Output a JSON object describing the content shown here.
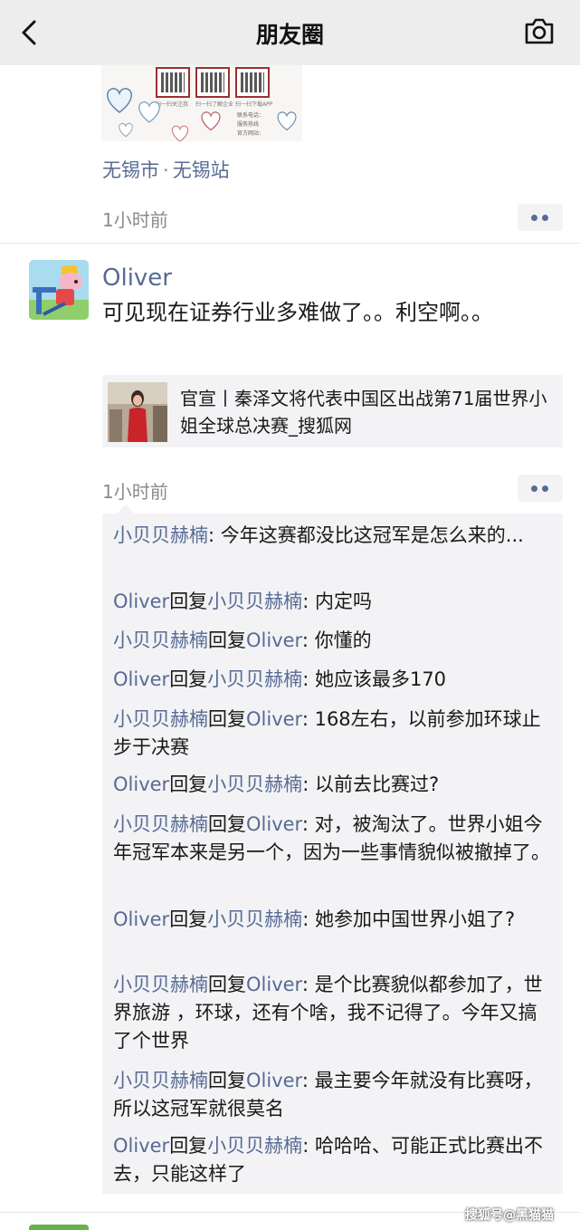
{
  "header": {
    "title": "朋友圈",
    "back_icon": "chevron-left-icon",
    "camera_icon": "camera-icon"
  },
  "prev_post": {
    "image": {
      "qr_captions": [
        "扫一扫关注我",
        "扫一扫了解企业",
        "扫一扫下载APP"
      ],
      "text_lines": [
        "联系电话：",
        "服务热线",
        "官方网站："
      ]
    },
    "location": {
      "city": "无锡市",
      "separator": "·",
      "place": "无锡站"
    },
    "time": "1小时前"
  },
  "post": {
    "nickname": "Oliver",
    "text": "可见现在证券行业多难做了。。利空啊。。",
    "link": {
      "title": "官宣丨秦泽文将代表中国区出战第71届世界小姐全球总决赛_搜狐网"
    },
    "time": "1小时前",
    "comments": [
      {
        "from": "小贝贝赫楠",
        "reply_word": "",
        "to": "",
        "sep": ": ",
        "text": "今年这赛都没比这冠军是怎么来的..."
      },
      {
        "from": "Oliver",
        "reply_word": "回复",
        "to": "小贝贝赫楠",
        "sep": ": ",
        "text": "内定吗"
      },
      {
        "from": "小贝贝赫楠",
        "reply_word": "回复",
        "to": "Oliver",
        "sep": ": ",
        "text": "你懂的"
      },
      {
        "from": "Oliver",
        "reply_word": "回复",
        "to": "小贝贝赫楠",
        "sep": ": ",
        "text": "她应该最多170"
      },
      {
        "from": "小贝贝赫楠",
        "reply_word": "回复",
        "to": "Oliver",
        "sep": ": ",
        "text": "168左右，以前参加环球止步于决赛"
      },
      {
        "from": "Oliver",
        "reply_word": "回复",
        "to": "小贝贝赫楠",
        "sep": ": ",
        "text": "以前去比赛过?"
      },
      {
        "from": "小贝贝赫楠",
        "reply_word": "回复",
        "to": "Oliver",
        "sep": ": ",
        "text": "对，被淘汰了。世界小姐今年冠军本来是另一个，因为一些事情貌似被撤掉了。"
      },
      {
        "from": "Oliver",
        "reply_word": "回复",
        "to": "小贝贝赫楠",
        "sep": ": ",
        "text": "她参加中国世界小姐了?"
      },
      {
        "from": "小贝贝赫楠",
        "reply_word": "回复",
        "to": "Oliver",
        "sep": ": ",
        "text": "是个比赛貌似都参加了，世界旅游 ，环球，还有个啥，我不记得了。今年又搞了个世界"
      },
      {
        "from": "小贝贝赫楠",
        "reply_word": "回复",
        "to": "Oliver",
        "sep": ": ",
        "text": "最主要今年就没有比赛呀，所以这冠军就很莫名"
      },
      {
        "from": "Oliver",
        "reply_word": "回复",
        "to": "小贝贝赫楠",
        "sep": ": ",
        "text": "哈哈哈、可能正式比赛出不去，只能这样了"
      }
    ]
  },
  "watermark": "搜狐号@黑猫猫",
  "colors": {
    "name_blue": "#576b95",
    "nav_bg": "#ededed",
    "comment_bg": "#f3f3f5",
    "time_gray": "#8b8b8b"
  }
}
